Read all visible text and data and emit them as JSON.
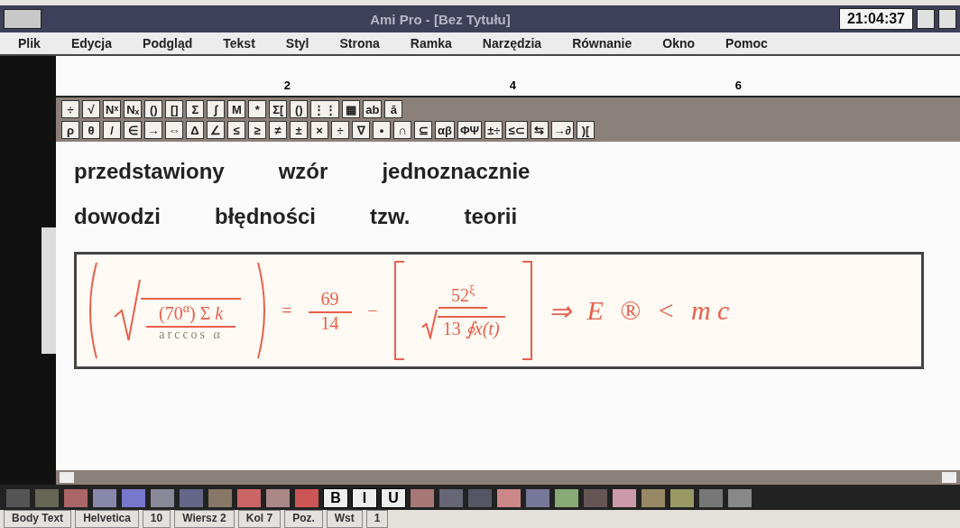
{
  "window": {
    "title": "Ami Pro - [Bez Tytułu]",
    "clock": "21:04:37"
  },
  "menu": [
    {
      "label": "Plik"
    },
    {
      "label": "Edycja"
    },
    {
      "label": "Podgląd"
    },
    {
      "label": "Tekst"
    },
    {
      "label": "Styl"
    },
    {
      "label": "Strona"
    },
    {
      "label": "Ramka"
    },
    {
      "label": "Narzędzia"
    },
    {
      "label": "Równanie"
    },
    {
      "label": "Okno"
    },
    {
      "label": "Pomoc"
    }
  ],
  "ruler": {
    "marks": [
      "2",
      "4",
      "6"
    ]
  },
  "equation_toolbar": {
    "row_1": [
      "÷",
      "√",
      "Nˣ",
      "Nₓ",
      "()",
      "[]",
      "Σ",
      "∫",
      "M",
      "*",
      "Σ[",
      "()",
      "⋮⋮",
      "▦",
      "ab",
      "ā"
    ],
    "row_2": [
      "ρ",
      "θ",
      "/",
      "∈",
      "→",
      "⇔",
      "Δ",
      "∠",
      "≤",
      "≥",
      "≠",
      "±",
      "×",
      "÷",
      "∇",
      "•",
      "∩",
      "⊆",
      "αβ",
      "ΦΨ",
      "±÷",
      "≤⊂",
      "⇆",
      "→∂",
      ")["
    ]
  },
  "document": {
    "lines": [
      [
        "przedstawiony",
        "wzór",
        "jednoznacznie"
      ],
      [
        "dowodzi",
        "błędności",
        "tzw.",
        "teorii"
      ]
    ]
  },
  "equation": {
    "root_numerator": "(70$^{α}$) Σ *k*",
    "root_denominator": "arccos α",
    "equals": "=",
    "fraction": [
      "69",
      "14"
    ],
    "minus": "−",
    "bracket_numerator": "52$^{ξ}$",
    "bracket_root": "13 *∮x(t)*",
    "tail": [
      "⇒",
      "E",
      "®",
      "<",
      "m c"
    ]
  },
  "format_toolbar": [
    "B",
    "I",
    "U"
  ],
  "status_bar": [
    "Body Text",
    "Helvetica",
    "10",
    "Wiersz 2",
    "Kol 7",
    "Poz.",
    "Wst",
    "1"
  ]
}
